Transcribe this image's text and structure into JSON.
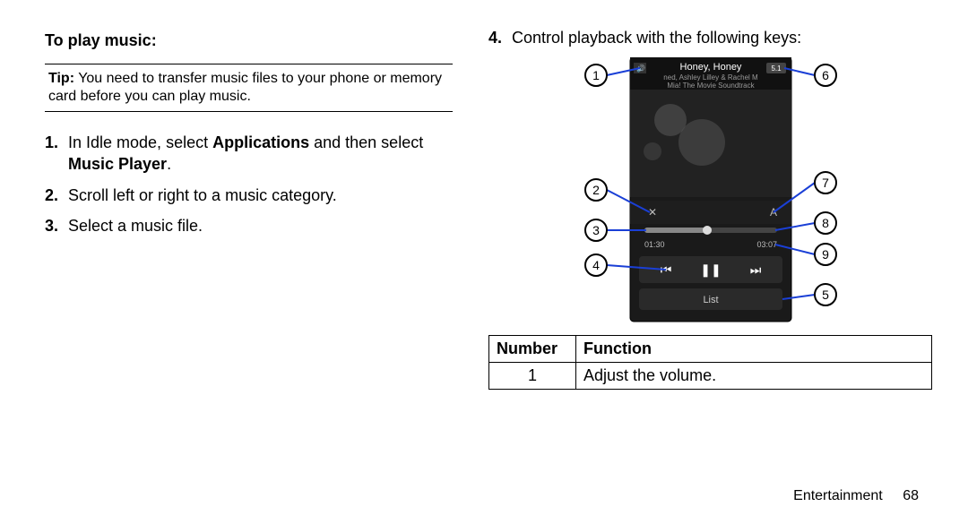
{
  "left": {
    "heading": "To play music:",
    "tip_label": "Tip:",
    "tip_body": "You need to transfer music files to your phone or memory card before you can play music.",
    "step1_num": "1.",
    "step1_a": "In Idle mode, select ",
    "step1_b": "Applications",
    "step1_c": " and then select ",
    "step1_d": "Music Player",
    "step1_e": ".",
    "step2_num": "2.",
    "step2": "Scroll left or right to a music category.",
    "step3_num": "3.",
    "step3": "Select a music file."
  },
  "right": {
    "step4_num": "4.",
    "step4": "Control playback with the following keys:",
    "callouts": {
      "c1": "1",
      "c2": "2",
      "c3": "3",
      "c4": "4",
      "c5": "5",
      "c6": "6",
      "c7": "7",
      "c8": "8",
      "c9": "9"
    },
    "player": {
      "title": "Honey, Honey",
      "sub1": "ned, Ashley Lilley & Rachel M",
      "sub2": "Mia! The Movie Soundtrack",
      "badge": "5.1",
      "time_l": "01:30",
      "time_r": "03:07",
      "list": "List"
    },
    "table": {
      "h1": "Number",
      "h2": "Function",
      "r1_n": "1",
      "r1_f": "Adjust the volume."
    }
  },
  "footer": {
    "section": "Entertainment",
    "page": "68"
  }
}
